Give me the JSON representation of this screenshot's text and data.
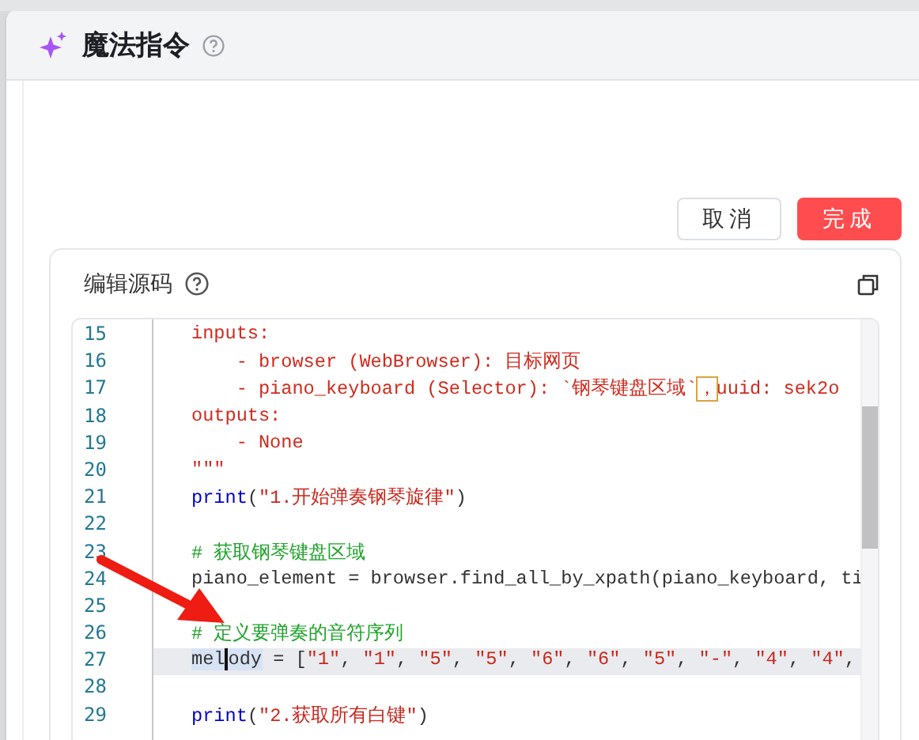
{
  "dialog": {
    "title": "魔法指令"
  },
  "buttons": [
    {
      "label": "取消",
      "kind": "secondary"
    },
    {
      "label": "完成",
      "kind": "primary"
    }
  ],
  "editor": {
    "title": "编辑源码",
    "lines": [
      {
        "number": "15",
        "current": false,
        "segments": [
          {
            "text": "inputs:",
            "kind": "doc"
          }
        ]
      },
      {
        "number": "16",
        "current": false,
        "segments": [
          {
            "text": "    - browser (WebBrowser): 目标网页",
            "kind": "doc"
          }
        ]
      },
      {
        "number": "17",
        "current": false,
        "segments": [
          {
            "text": "    - piano_keyboard (Selector): `钢琴键盘区域`",
            "kind": "doc"
          },
          {
            "text": "，",
            "kind": "boxed"
          },
          {
            "text": "uuid: sek2o",
            "kind": "doc"
          }
        ]
      },
      {
        "number": "18",
        "current": false,
        "segments": [
          {
            "text": "outputs:",
            "kind": "doc"
          }
        ]
      },
      {
        "number": "19",
        "current": false,
        "segments": [
          {
            "text": "    - None",
            "kind": "doc"
          }
        ]
      },
      {
        "number": "20",
        "current": false,
        "segments": [
          {
            "text": "\"\"\"",
            "kind": "doc"
          }
        ]
      },
      {
        "number": "21",
        "current": false,
        "segments": [
          {
            "text": "print",
            "kind": "keyword"
          },
          {
            "text": "(",
            "kind": "plain"
          },
          {
            "text": "\"1.开始弹奏钢琴旋律\"",
            "kind": "string"
          },
          {
            "text": ")",
            "kind": "plain"
          }
        ]
      },
      {
        "number": "22",
        "current": false
      },
      {
        "number": "23",
        "current": false,
        "segments": [
          {
            "text": "# 获取钢琴键盘区域",
            "kind": "comment"
          }
        ]
      },
      {
        "number": "24",
        "current": false,
        "segments": [
          {
            "text": "piano_element = browser.find_all_by_xpath(piano_keyboard, ti",
            "kind": "plain"
          }
        ]
      },
      {
        "number": "25",
        "current": false
      },
      {
        "number": "26",
        "current": false,
        "segments": [
          {
            "text": "# 定义要弹奏的音符序列",
            "kind": "comment"
          }
        ]
      },
      {
        "number": "27",
        "current": true,
        "segments": [
          {
            "text": "mel",
            "kind": "selected",
            "caret": true
          },
          {
            "text": "ody",
            "kind": "selected"
          },
          {
            "text": " = [",
            "kind": "plain"
          },
          {
            "text": "\"1\"",
            "kind": "string"
          },
          {
            "text": ", ",
            "kind": "plain"
          },
          {
            "text": "\"1\"",
            "kind": "string"
          },
          {
            "text": ", ",
            "kind": "plain"
          },
          {
            "text": "\"5\"",
            "kind": "string"
          },
          {
            "text": ", ",
            "kind": "plain"
          },
          {
            "text": "\"5\"",
            "kind": "string"
          },
          {
            "text": ", ",
            "kind": "plain"
          },
          {
            "text": "\"6\"",
            "kind": "string"
          },
          {
            "text": ", ",
            "kind": "plain"
          },
          {
            "text": "\"6\"",
            "kind": "string"
          },
          {
            "text": ", ",
            "kind": "plain"
          },
          {
            "text": "\"5\"",
            "kind": "string"
          },
          {
            "text": ", ",
            "kind": "plain"
          },
          {
            "text": "\"-\"",
            "kind": "string"
          },
          {
            "text": ", ",
            "kind": "plain"
          },
          {
            "text": "\"4\"",
            "kind": "string"
          },
          {
            "text": ", ",
            "kind": "plain"
          },
          {
            "text": "\"4\"",
            "kind": "string"
          },
          {
            "text": ",",
            "kind": "plain"
          }
        ]
      },
      {
        "number": "28",
        "current": false
      },
      {
        "number": "29",
        "current": false,
        "segments": [
          {
            "text": "print",
            "kind": "keyword"
          },
          {
            "text": "(",
            "kind": "plain"
          },
          {
            "text": "\"2.获取所有白键\"",
            "kind": "string"
          },
          {
            "text": ")",
            "kind": "plain"
          }
        ]
      }
    ]
  }
}
